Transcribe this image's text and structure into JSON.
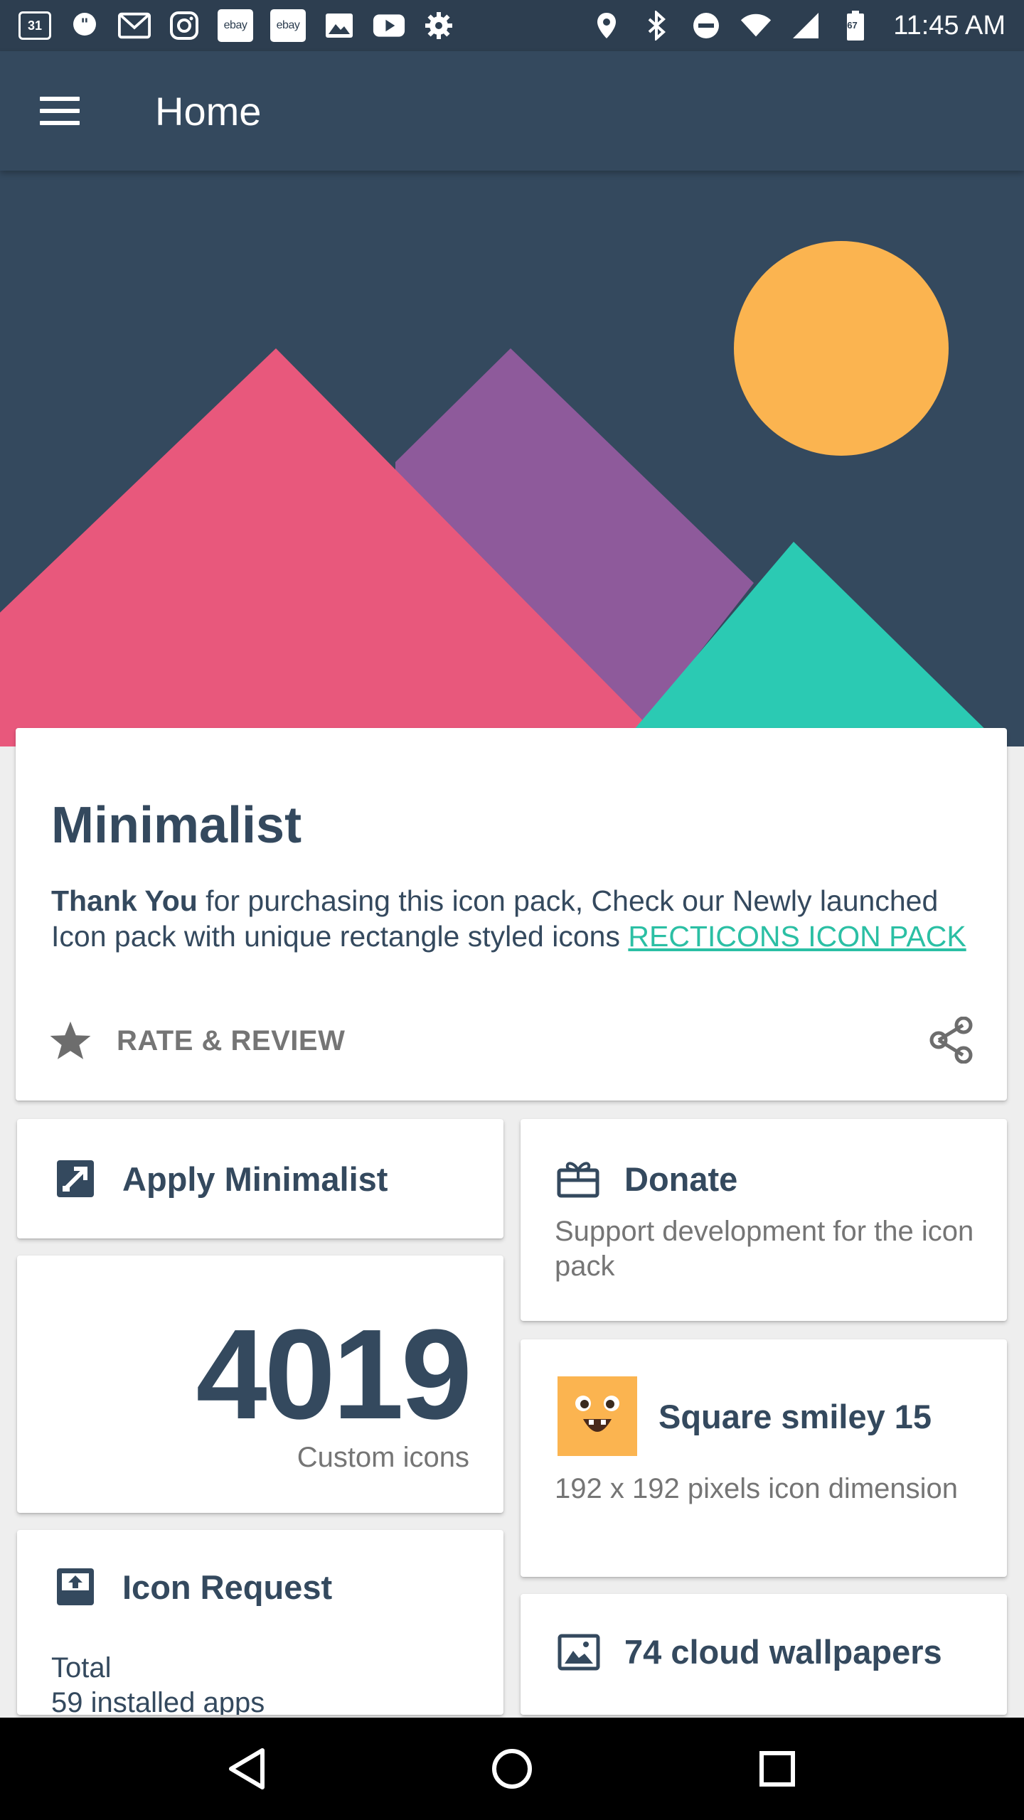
{
  "status_bar": {
    "calendar_day": "31",
    "ebay_1": "ebay",
    "ebay_2": "ebay",
    "battery_level": "67",
    "time": "11:45 AM"
  },
  "app_bar": {
    "title": "Home"
  },
  "hero": {
    "colors": {
      "background": "#34495e",
      "sun": "#fbb450",
      "mountain_pink": "#e8587c",
      "mountain_purple": "#8e5a9b",
      "mountain_teal": "#2bcab3"
    }
  },
  "main_card": {
    "title": "Minimalist",
    "text_bold": "Thank You",
    "text_body": " for purchasing this icon pack, Check our Newly launched Icon pack with unique rectangle styled icons ",
    "link_text": "RECTICONS ICON PACK",
    "rate_label": "RATE & REVIEW"
  },
  "apply_card": {
    "title": "Apply Minimalist"
  },
  "count_card": {
    "count": "4019",
    "label": "Custom icons"
  },
  "request_card": {
    "title": "Icon Request",
    "line1": "Total",
    "line2": "59 installed apps"
  },
  "donate_card": {
    "title": "Donate",
    "subtitle": "Support development for the icon pack"
  },
  "smiley_card": {
    "title": "Square smiley 15",
    "subtitle": "192 x 192 pixels icon dimension",
    "icon_color": "#fbb450"
  },
  "wallpaper_card": {
    "title": "74 cloud wallpapers"
  },
  "colors": {
    "primary": "#34495e",
    "status_bar": "#2d3e50",
    "accent": "#2bbfa4"
  }
}
